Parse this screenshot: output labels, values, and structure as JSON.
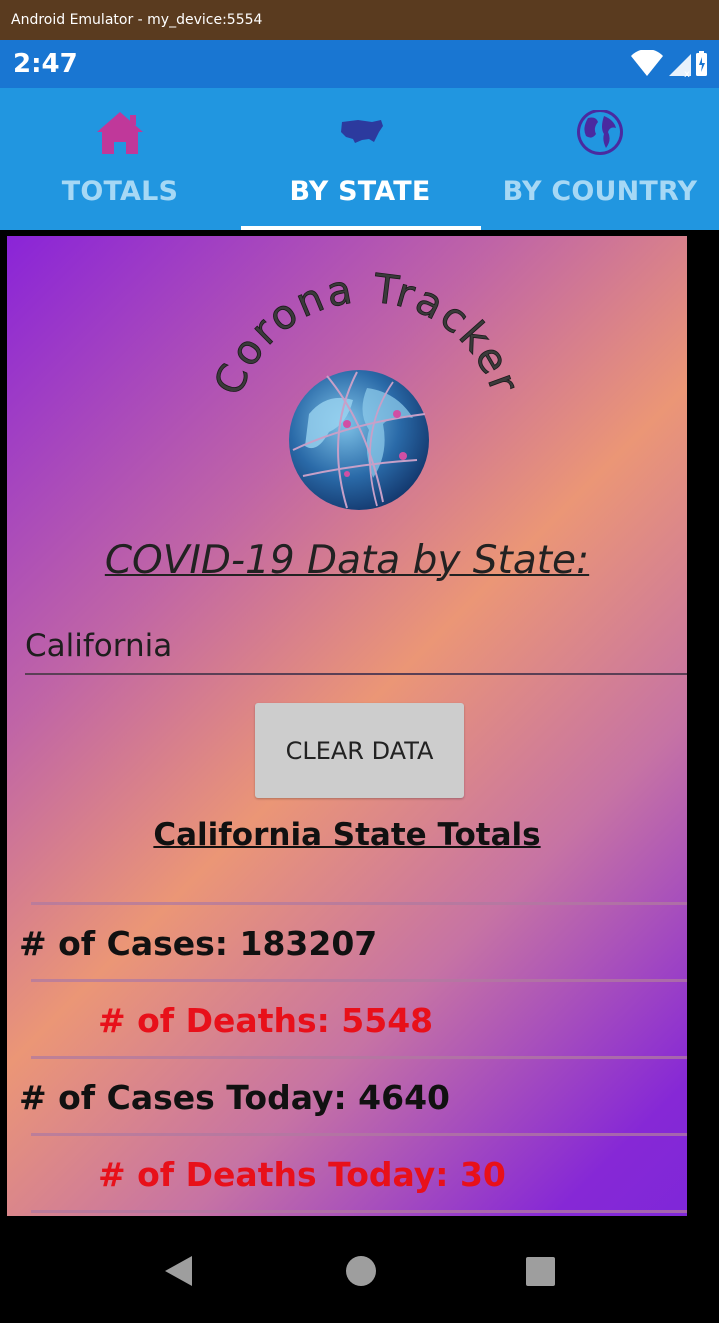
{
  "window": {
    "title": "Android Emulator - my_device:5554"
  },
  "status_bar": {
    "time": "2:47",
    "icons": [
      "wifi-icon",
      "signal-icon",
      "battery-icon"
    ]
  },
  "tabs": [
    {
      "label": "TOTALS",
      "icon": "home-icon",
      "active": false
    },
    {
      "label": "BY STATE",
      "icon": "usa-map-icon",
      "active": true
    },
    {
      "label": "BY COUNTRY",
      "icon": "globe-icon",
      "active": false
    }
  ],
  "logo": {
    "text": "Corona Tracker"
  },
  "main": {
    "heading": "COVID-19 Data by State:",
    "state_input": {
      "value": "California",
      "placeholder": ""
    },
    "clear_button": "CLEAR DATA",
    "totals_title": "California State Totals",
    "stats": [
      {
        "label": "# of Cases: 183207",
        "color": "#111111"
      },
      {
        "label": "# of Deaths: 5548",
        "color": "#e8101a"
      },
      {
        "label": "# of Cases Today: 4640",
        "color": "#111111"
      },
      {
        "label": "# of Deaths Today: 30",
        "color": "#e8101a"
      }
    ]
  },
  "nav": {
    "icons": [
      "back-icon",
      "home-circle-icon",
      "recents-icon"
    ]
  },
  "colors": {
    "app_bar": "#2196e0",
    "status_bar": "#1976d2",
    "tab_inactive": "#a6d8f5",
    "home_icon": "#c0389a",
    "globe_icon": "#4a2aa0"
  }
}
